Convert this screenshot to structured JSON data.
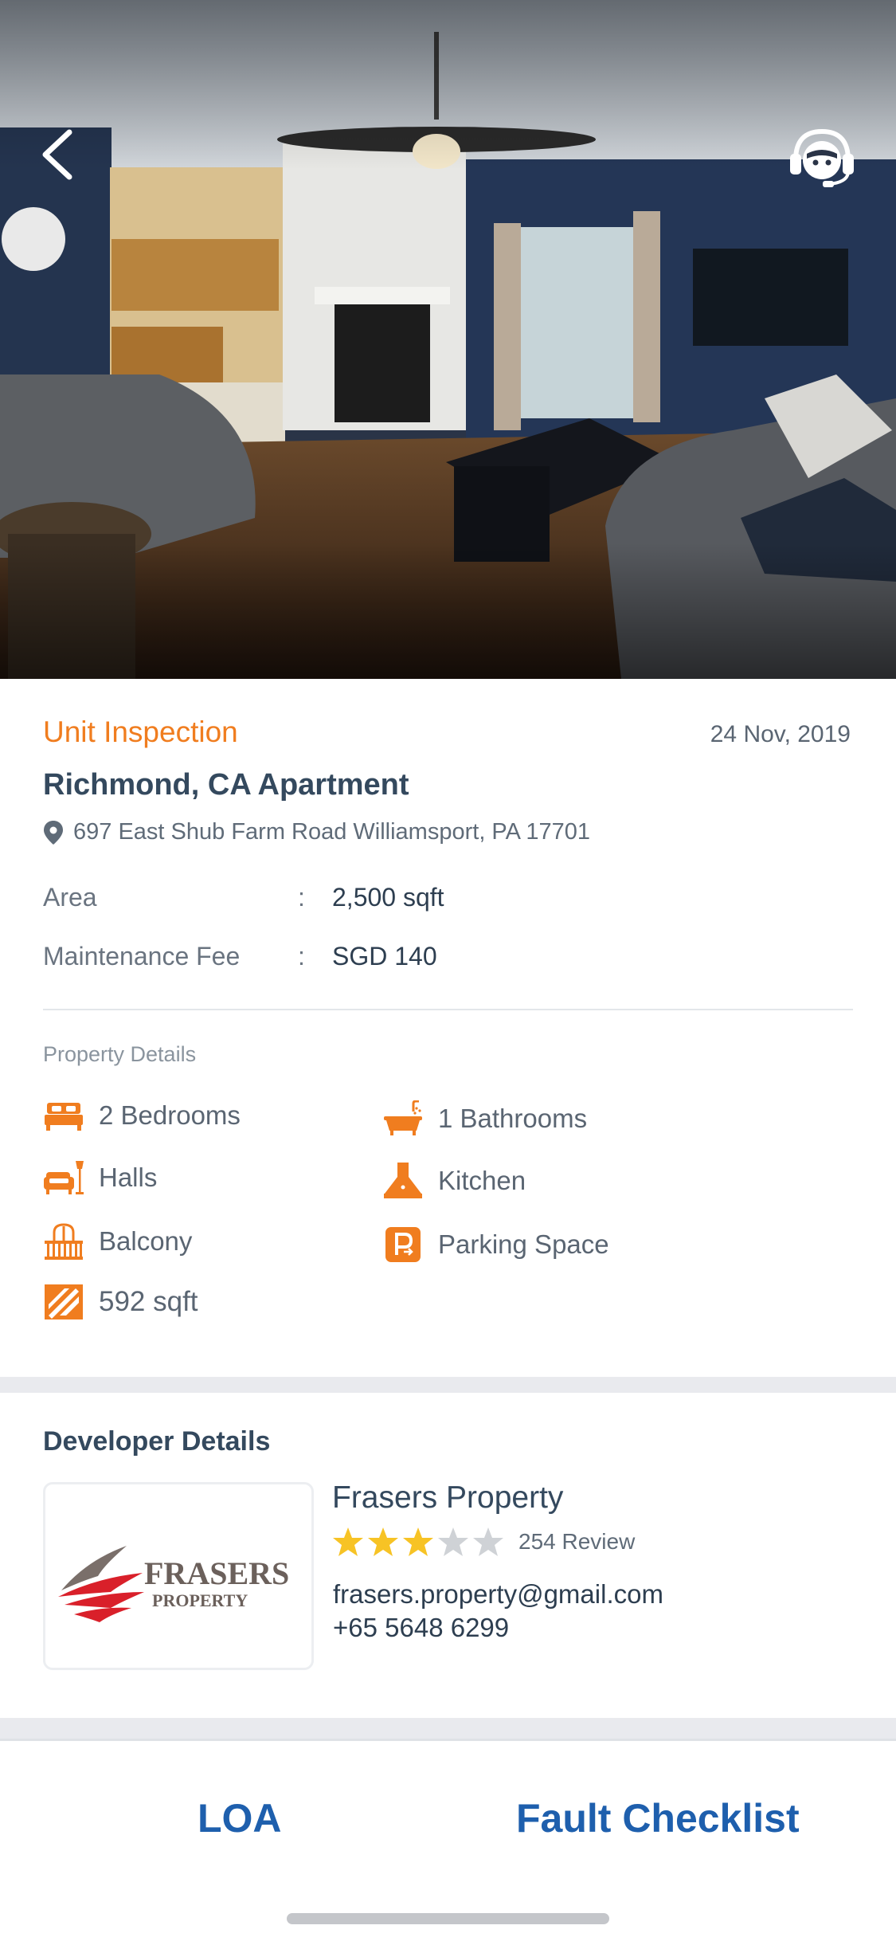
{
  "header": {
    "back_icon": "chevron-left-icon",
    "support_icon": "support-agent-icon"
  },
  "inspection": {
    "category": "Unit Inspection",
    "date": "24 Nov, 2019",
    "title": "Richmond, CA Apartment",
    "address": "697 East Shub Farm Road Williamsport, PA 17701",
    "area_label": "Area",
    "area_value": "2,500 sqft",
    "fee_label": "Maintenance Fee",
    "fee_value": "SGD 140",
    "separator": ":"
  },
  "property_details": {
    "heading": "Property Details",
    "items": [
      {
        "label": "2 Bedrooms",
        "icon": "bed-icon"
      },
      {
        "label": "1 Bathrooms",
        "icon": "bathtub-icon"
      },
      {
        "label": "Halls",
        "icon": "sofa-lamp-icon"
      },
      {
        "label": "Kitchen",
        "icon": "kitchen-hood-icon"
      },
      {
        "label": "Balcony",
        "icon": "balcony-icon"
      },
      {
        "label": "Parking Space",
        "icon": "parking-icon"
      },
      {
        "label": "592 sqft",
        "icon": "area-icon"
      }
    ]
  },
  "developer": {
    "heading": "Developer Details",
    "name": "Frasers Property",
    "logo_text": "FRASERS",
    "logo_subtext": "PROPERTY",
    "rating": 3,
    "rating_max": 5,
    "review": "254 Review",
    "email": "frasers.property@gmail.com",
    "phone": "+65 5648 6299"
  },
  "actions": {
    "loa": "LOA",
    "fault_checklist": "Fault Checklist"
  },
  "colors": {
    "accent": "#f07d1f",
    "primary_button": "#1e5fad",
    "star_filled": "#f7c325",
    "star_empty": "#cfd2d6"
  }
}
